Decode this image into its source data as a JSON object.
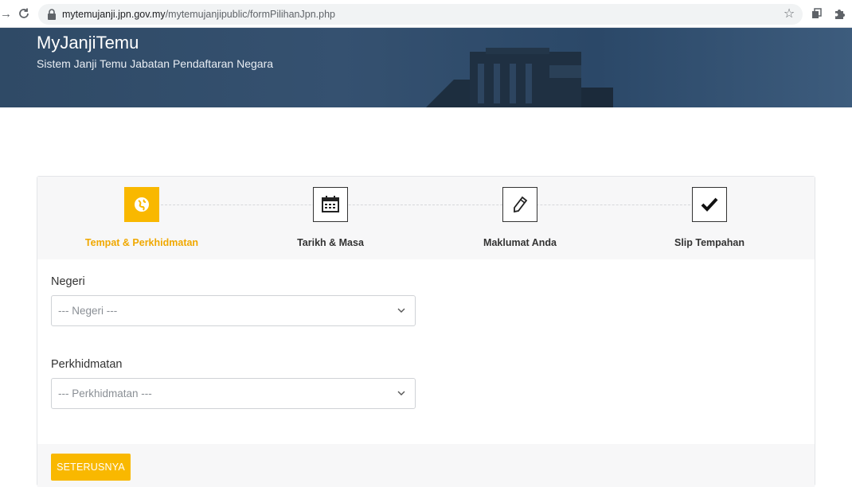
{
  "browser": {
    "url_domain": "mytemujanji.jpn.gov.my",
    "url_path": "/mytemujanjipublic/formPilihanJpn.php"
  },
  "header": {
    "title": "MyJanjiTemu",
    "subtitle": "Sistem Janji Temu Jabatan Pendaftaran Negara"
  },
  "steps": [
    {
      "label": "Tempat & Perkhidmatan",
      "icon": "globe-icon",
      "active": true
    },
    {
      "label": "Tarikh & Masa",
      "icon": "calendar-icon",
      "active": false
    },
    {
      "label": "Maklumat Anda",
      "icon": "pencil-icon",
      "active": false
    },
    {
      "label": "Slip Tempahan",
      "icon": "checkmark-icon",
      "active": false
    }
  ],
  "form": {
    "negeri": {
      "label": "Negeri",
      "value": "--- Negeri ---"
    },
    "perkhidmatan": {
      "label": "Perkhidmatan",
      "value": "--- Perkhidmatan ---"
    }
  },
  "actions": {
    "next_label": "SETERUSNYA"
  },
  "colors": {
    "accent": "#f9b800",
    "banner": "#2f4a66"
  }
}
